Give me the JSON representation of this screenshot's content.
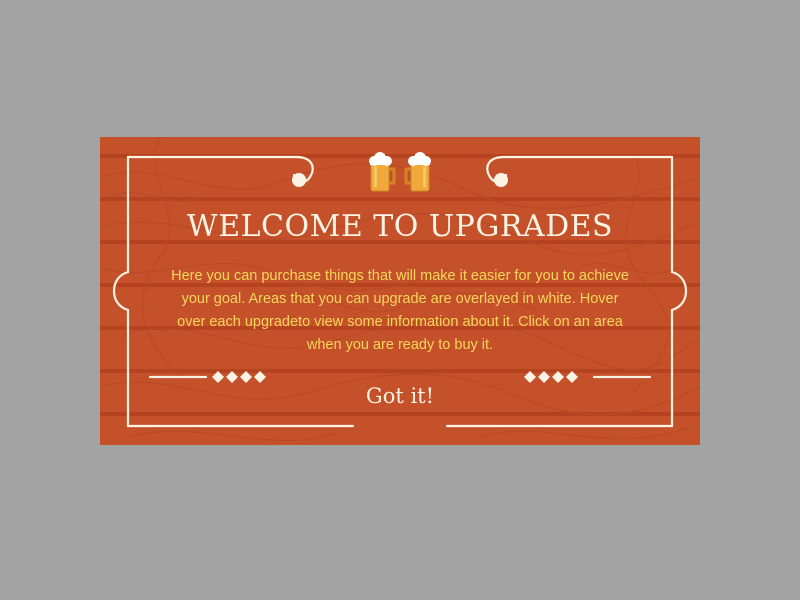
{
  "dialog": {
    "title": "WELCOME TO UPGRADES",
    "message": "Here you can purchase things that will make it easier for you to achieve your goal. Areas that you can upgrade are overlayed in white. Hover over each upgradeto view some information about it. Click on an area when you are ready to buy it.",
    "confirm_label": "Got it!",
    "icons": [
      "beer-mug-icon",
      "beer-mug-icon"
    ]
  },
  "colors": {
    "backdrop": "#a4a3a4",
    "panel": "#c4512a",
    "stripes": "#b5431f",
    "frame": "#fbf3e4",
    "title": "#fbf3e4",
    "message": "#f8d65a",
    "beer": "#f2a93b",
    "foam": "#ffffff"
  }
}
